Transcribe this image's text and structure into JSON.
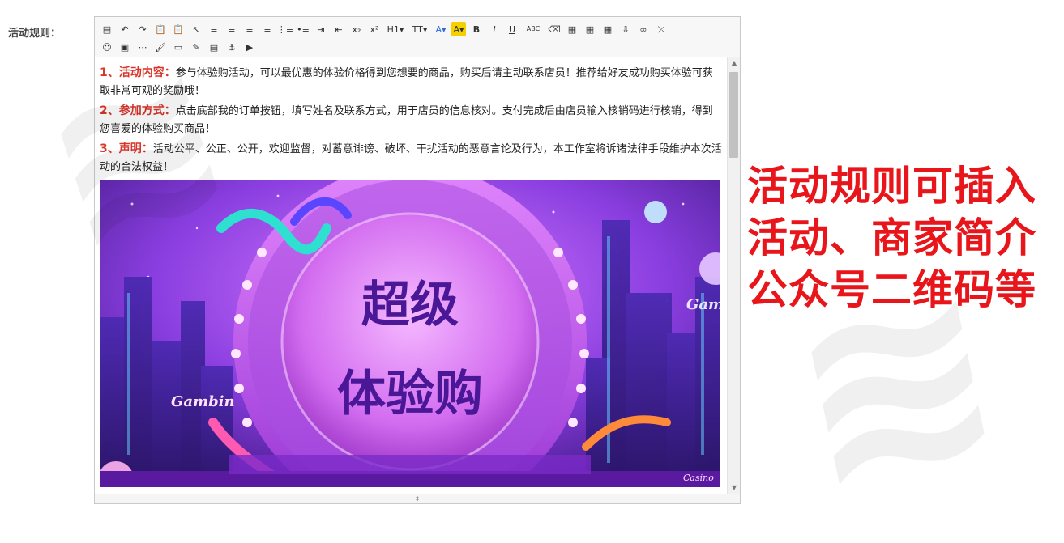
{
  "form": {
    "label": "活动规则："
  },
  "toolbar": {
    "row1": [
      {
        "name": "source-icon",
        "glyph": "▤"
      },
      {
        "name": "undo-icon",
        "glyph": "↶"
      },
      {
        "name": "redo-icon",
        "glyph": "↷"
      },
      {
        "name": "paste-icon",
        "glyph": "📋"
      },
      {
        "name": "paste-text-icon",
        "glyph": "📋"
      },
      {
        "name": "select-icon",
        "glyph": "↖"
      },
      {
        "name": "align-left-icon",
        "glyph": "≡"
      },
      {
        "name": "align-center-icon",
        "glyph": "≡"
      },
      {
        "name": "align-right-icon",
        "glyph": "≡"
      },
      {
        "name": "align-justify-icon",
        "glyph": "≡"
      },
      {
        "name": "ordered-list-icon",
        "glyph": "⋮≡"
      },
      {
        "name": "unordered-list-icon",
        "glyph": "•≡"
      },
      {
        "name": "indent-icon",
        "glyph": "⇥"
      },
      {
        "name": "outdent-icon",
        "glyph": "⇤"
      },
      {
        "name": "subscript-icon",
        "glyph": "x₂"
      },
      {
        "name": "superscript-icon",
        "glyph": "x²"
      },
      {
        "name": "heading-icon",
        "glyph": "H1▾"
      },
      {
        "name": "font-size-icon",
        "glyph": "TT▾"
      },
      {
        "name": "font-color-icon",
        "glyph": "A▾"
      },
      {
        "name": "highlight-icon",
        "glyph": "A▾"
      },
      {
        "name": "bold-icon",
        "glyph": "B"
      },
      {
        "name": "italic-icon",
        "glyph": "I"
      },
      {
        "name": "underline-icon",
        "glyph": "U"
      },
      {
        "name": "strikethrough-icon",
        "glyph": "ABC"
      },
      {
        "name": "clear-format-icon",
        "glyph": "⌫"
      },
      {
        "name": "insert-row-icon",
        "glyph": "▦"
      },
      {
        "name": "delete-row-icon",
        "glyph": "▦"
      },
      {
        "name": "table-icon",
        "glyph": "▦"
      },
      {
        "name": "insert-icon",
        "glyph": "⇩"
      },
      {
        "name": "link-icon",
        "glyph": "∞"
      },
      {
        "name": "unlink-icon",
        "glyph": "⤫"
      }
    ],
    "row2": [
      {
        "name": "emoticon-icon",
        "glyph": "☺"
      },
      {
        "name": "image-icon",
        "glyph": "▣"
      },
      {
        "name": "horizontal-rule-icon",
        "glyph": "⋯"
      },
      {
        "name": "format-painter-icon",
        "glyph": "🖌"
      },
      {
        "name": "page-break-icon",
        "glyph": "▭"
      },
      {
        "name": "template-icon",
        "glyph": "✎"
      },
      {
        "name": "preview-icon",
        "glyph": "▤"
      },
      {
        "name": "anchor-icon",
        "glyph": "⚓"
      },
      {
        "name": "video-icon",
        "glyph": "▶"
      }
    ]
  },
  "content": {
    "p1_lead": "1、活动内容：",
    "p1_text": "参与体验购活动，可以最优惠的体验价格得到您想要的商品，购买后请主动联系店员！推荐给好友成功购买体验可获取非常可观的奖励哦！",
    "p2_lead": "2、参加方式：",
    "p2_text": "点击底部我的订单按钮，填写姓名及联系方式，用于店员的信息核对。支付完成后由店员输入核销码进行核销，得到您喜爱的体验购买商品！",
    "p3_lead": "3、声明：",
    "p3_text": "活动公平、公正、公开，欢迎监督，对蓄意诽谤、破坏、干扰活动的恶意言论及行为，本工作室将诉诸法律手段维护本次活动的合法权益！"
  },
  "hero": {
    "line1": "超级",
    "line2": "体验购",
    "sign_left": "Gambin",
    "sign_right": "Gamb",
    "sign_bottom": "Casino"
  },
  "annotation": {
    "line1": "活动规则可插入",
    "line2": "活动、商家简介",
    "line3": "公众号二维码等"
  },
  "colors": {
    "accent_red": "#e8151b",
    "lead_red": "#d9352b",
    "hero_purple": "#8f3ad8"
  }
}
